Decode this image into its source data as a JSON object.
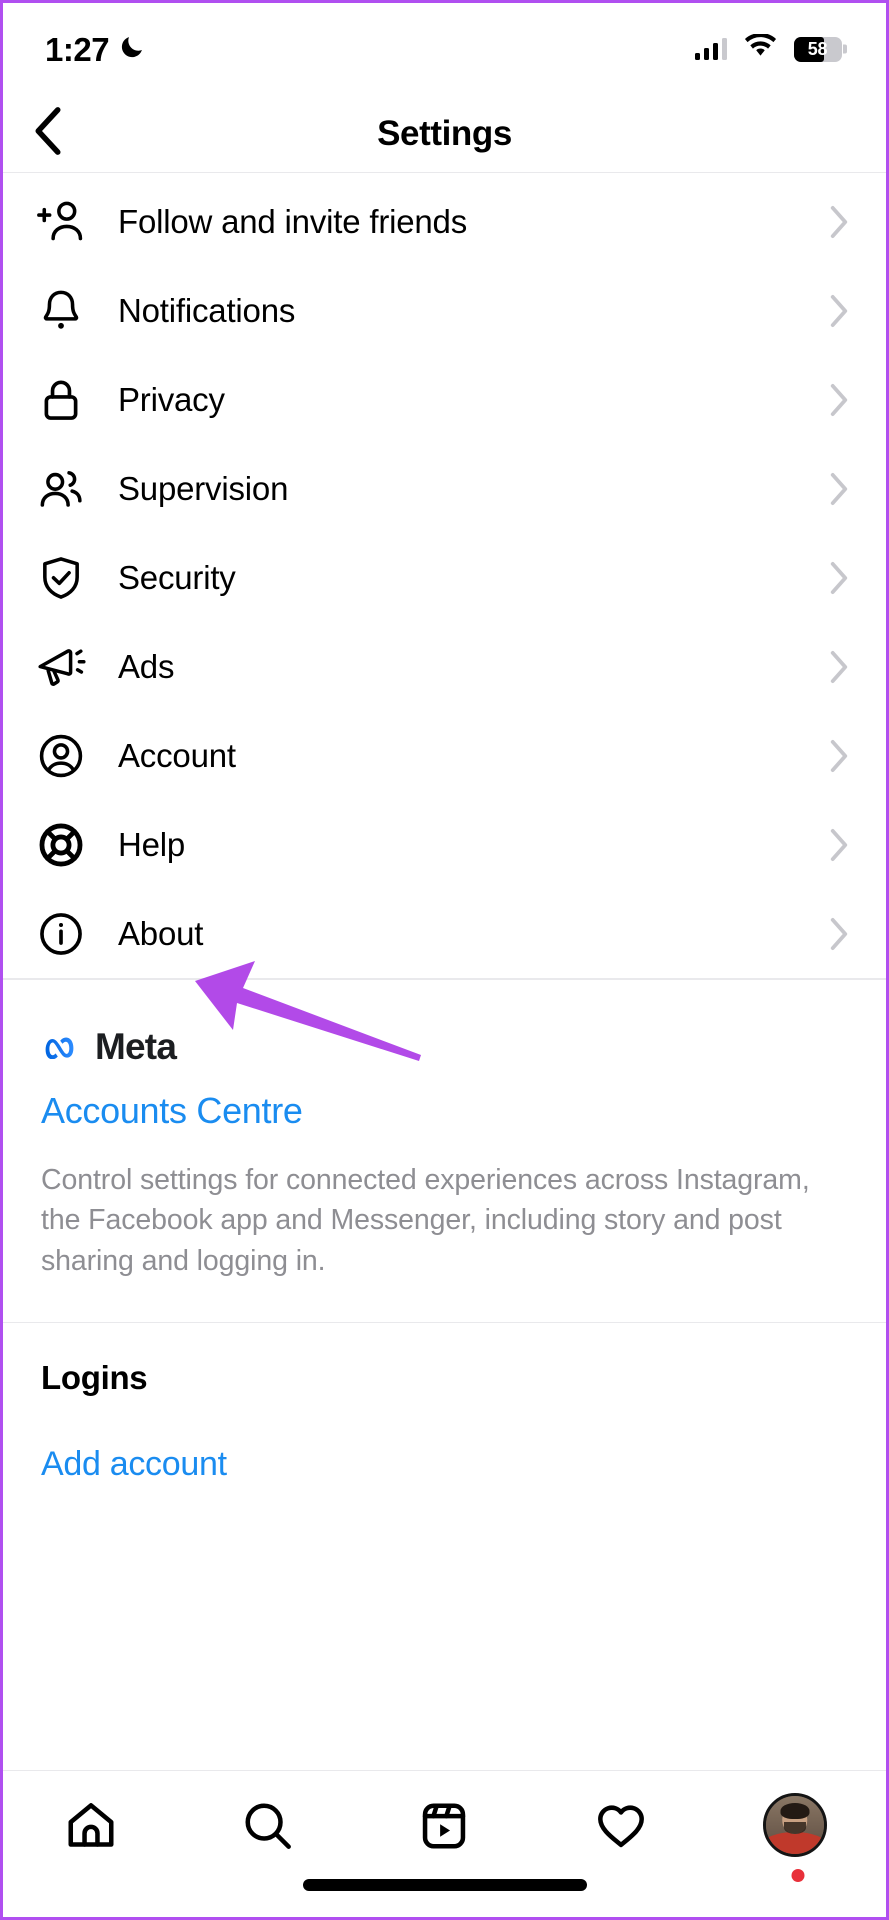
{
  "status_bar": {
    "time": "1:27",
    "moon_icon": "crescent-moon-icon",
    "cellular_icon": "cellular-signal-icon",
    "wifi_icon": "wifi-icon",
    "battery_percent": "58",
    "battery_icon": "battery-icon"
  },
  "nav": {
    "back_icon": "chevron-left-icon",
    "title": "Settings"
  },
  "menu": {
    "items": [
      {
        "label": "Follow and invite friends",
        "icon": "person-add-icon"
      },
      {
        "label": "Notifications",
        "icon": "bell-icon"
      },
      {
        "label": "Privacy",
        "icon": "lock-icon"
      },
      {
        "label": "Supervision",
        "icon": "two-people-icon"
      },
      {
        "label": "Security",
        "icon": "shield-check-icon"
      },
      {
        "label": "Ads",
        "icon": "megaphone-icon"
      },
      {
        "label": "Account",
        "icon": "person-circle-icon"
      },
      {
        "label": "Help",
        "icon": "life-ring-icon"
      },
      {
        "label": "About",
        "icon": "info-circle-icon"
      }
    ],
    "chevron_icon": "chevron-right-icon"
  },
  "meta_section": {
    "logo_icon": "meta-infinity-icon",
    "brand": "Meta",
    "link": "Accounts Centre",
    "description": "Control settings for connected experiences across Instagram, the Facebook app and Messenger, including story and post sharing and logging in."
  },
  "logins_section": {
    "title": "Logins",
    "add_account": "Add account"
  },
  "tab_bar": {
    "tabs": [
      {
        "icon": "home-icon",
        "name": "home"
      },
      {
        "icon": "search-icon",
        "name": "search"
      },
      {
        "icon": "reels-icon",
        "name": "reels"
      },
      {
        "icon": "heart-icon",
        "name": "activity"
      },
      {
        "icon": "profile-avatar-icon",
        "name": "profile"
      }
    ],
    "has_notification_dot": true
  },
  "annotation": {
    "arrow_icon": "pointer-arrow-icon",
    "arrow_color": "#b24ae8",
    "points_at": "Help"
  },
  "colors": {
    "link_blue": "#1a8cf0",
    "meta_blue": "#1877f2",
    "muted_gray": "#8e8e93",
    "divider": "#e9e9ec",
    "frame_purple": "#b04ff0",
    "notification_red": "#e8303a"
  }
}
